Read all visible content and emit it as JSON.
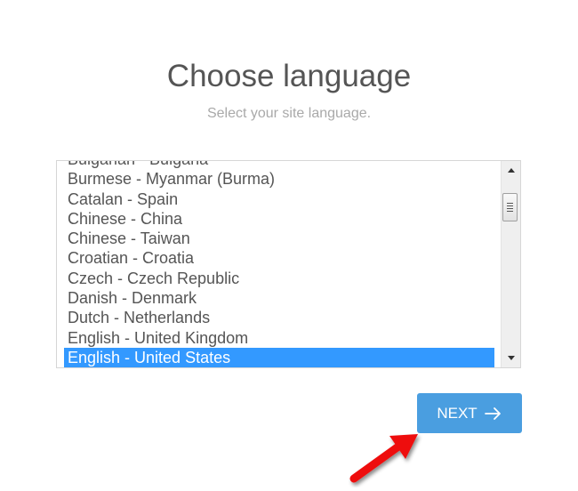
{
  "header": {
    "title": "Choose language",
    "subtitle": "Select your site language."
  },
  "language_list": {
    "items": [
      "Bulgarian - Bulgaria",
      "Burmese - Myanmar (Burma)",
      "Catalan - Spain",
      "Chinese - China",
      "Chinese - Taiwan",
      "Croatian - Croatia",
      "Czech - Czech Republic",
      "Danish - Denmark",
      "Dutch - Netherlands",
      "English - United Kingdom",
      "English - United States"
    ],
    "selected": "English - United States",
    "selected_index": 10
  },
  "next_button": {
    "label": "NEXT",
    "icon": "arrow-right-icon"
  },
  "annotation": {
    "icon": "red-pointer-arrow-icon",
    "color": "#ee1111"
  },
  "colors": {
    "accent": "#4a9ee0",
    "selection": "#3399ff",
    "title": "#555555",
    "subtitle": "#a9a9a9"
  }
}
